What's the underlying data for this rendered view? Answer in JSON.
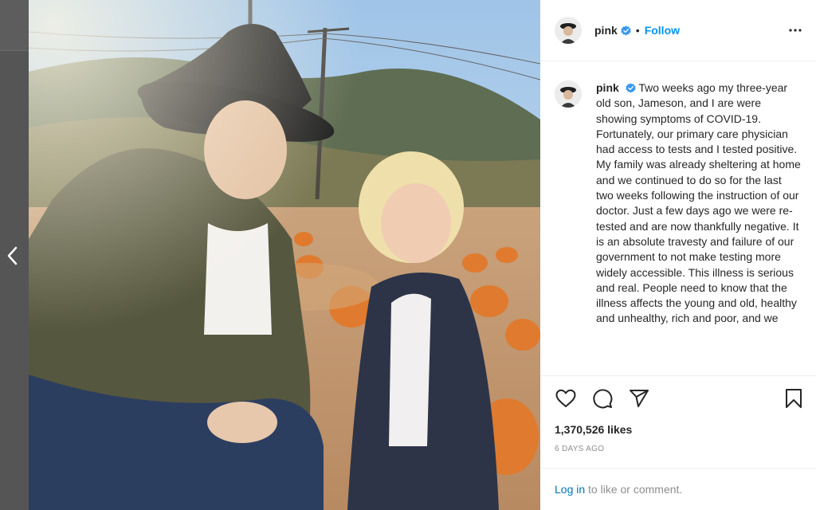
{
  "post": {
    "username": "pink",
    "separator": "•",
    "follow_label": "Follow",
    "caption": "Two weeks ago my three-year old son, Jameson, and I are were showing symptoms of COVID-19. Fortunately, our primary care physician had access to tests and I tested positive. My family was already sheltering at home and we continued to do so for the last two weeks following the instruction of our doctor. Just a few days ago we were re-tested and are now thankfully negative. It is an absolute travesty and failure of our government to not make testing more widely accessible. This illness is serious and real. People need to know that the illness affects the young and old, healthy and unhealthy, rich and poor, and we",
    "likes": "1,370,526 likes",
    "date": "6 DAYS AGO",
    "login_link": "Log in",
    "login_suffix": " to like or comment."
  },
  "icons": {
    "prev": "chevron-left-icon",
    "verified": "verified-badge-icon",
    "more": "more-options-icon",
    "like": "heart-icon",
    "comment": "comment-icon",
    "share": "send-icon",
    "save": "bookmark-icon"
  },
  "colors": {
    "accent": "#0095f6",
    "verified": "#3897f0",
    "text": "#262626",
    "muted": "#8e8e8e"
  }
}
